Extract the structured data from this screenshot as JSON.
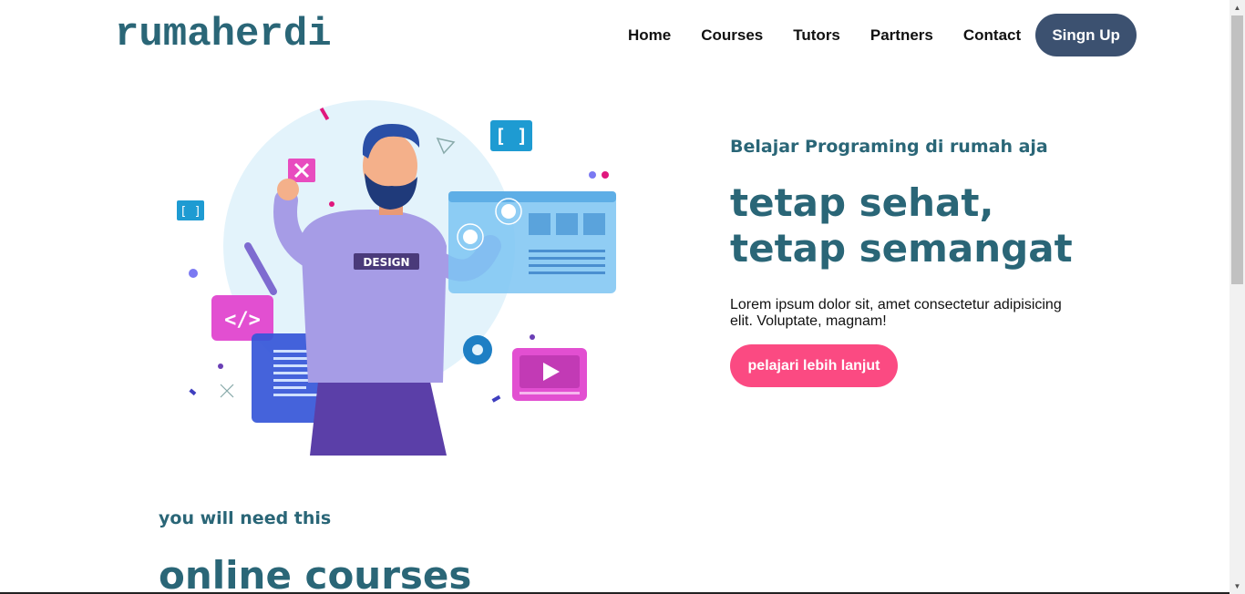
{
  "header": {
    "logo": "rumaherdi",
    "nav": [
      "Home",
      "Courses",
      "Tutors",
      "Partners",
      "Contact"
    ],
    "signup_label": "Singn Up"
  },
  "hero": {
    "subtitle": "Belajar Programing di rumah aja",
    "title_line1": "tetap sehat,",
    "title_line2": "tetap semangat",
    "description": "Lorem ipsum dolor sit, amet consectetur adipisicing elit. Voluptate, magnam!",
    "cta_label": "pelajari lebih lanjut",
    "illustration_badge": "DESIGN"
  },
  "section": {
    "subtitle": "you will need this",
    "title": "online courses"
  },
  "colors": {
    "brand_teal": "#2a6677",
    "signup_bg": "#3c5170",
    "cta_pink": "#fb4a82"
  }
}
